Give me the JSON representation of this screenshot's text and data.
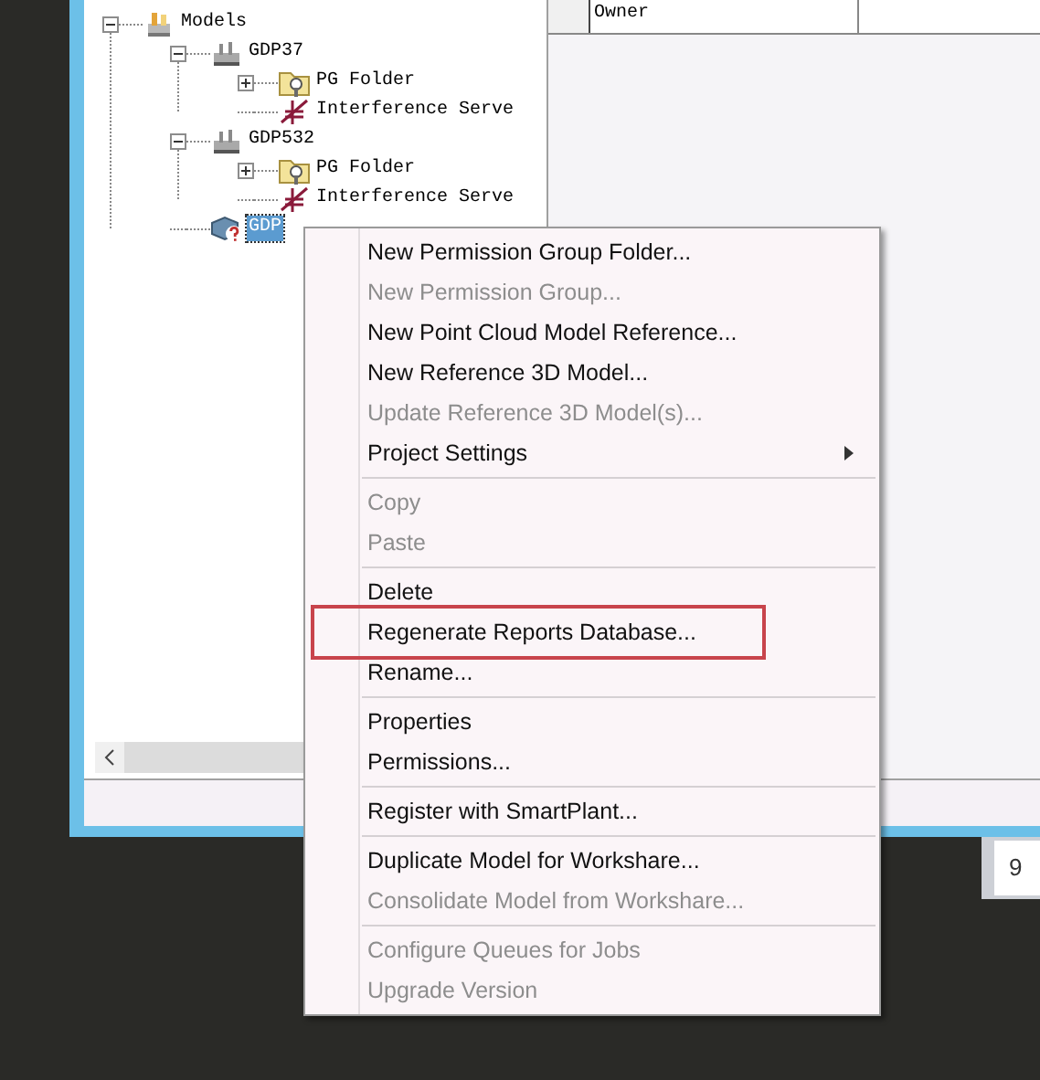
{
  "tree": [
    {
      "label": "Models",
      "kind": "models",
      "selected": false,
      "expanded": true,
      "children": [
        {
          "label": "GDP37",
          "kind": "model",
          "selected": false,
          "expanded": true,
          "children": [
            {
              "label": "PG Folder",
              "kind": "folder",
              "selected": false,
              "expanded": false
            },
            {
              "label": "Interference Serve",
              "kind": "interference",
              "selected": false
            }
          ]
        },
        {
          "label": "GDP532",
          "kind": "model",
          "selected": false,
          "expanded": true,
          "children": [
            {
              "label": "PG Folder",
              "kind": "folder",
              "selected": false,
              "expanded": false
            },
            {
              "label": "Interference Serve",
              "kind": "interference",
              "selected": false
            }
          ]
        },
        {
          "label": "GDP",
          "kind": "unknown-model",
          "selected": true
        }
      ]
    }
  ],
  "property_grid": {
    "rows": [
      {
        "label": "Owner"
      }
    ]
  },
  "other_window": {
    "text": "9"
  },
  "context_menu": [
    {
      "kind": "item",
      "label": "New Permission Group Folder...",
      "disabled": false
    },
    {
      "kind": "item",
      "label": "New Permission Group...",
      "disabled": true
    },
    {
      "kind": "item",
      "label": "New Point Cloud Model Reference...",
      "disabled": false
    },
    {
      "kind": "item",
      "label": "New Reference 3D Model...",
      "disabled": false
    },
    {
      "kind": "item",
      "label": "Update Reference 3D Model(s)...",
      "disabled": true
    },
    {
      "kind": "item",
      "label": "Project Settings",
      "disabled": false,
      "submenu": true
    },
    {
      "kind": "separator"
    },
    {
      "kind": "item",
      "label": "Copy",
      "disabled": true
    },
    {
      "kind": "item",
      "label": "Paste",
      "disabled": true
    },
    {
      "kind": "separator"
    },
    {
      "kind": "item",
      "label": "Delete",
      "disabled": false
    },
    {
      "kind": "item",
      "label": "Regenerate Reports Database...",
      "disabled": false,
      "highlighted": true
    },
    {
      "kind": "item",
      "label": "Rename...",
      "disabled": false
    },
    {
      "kind": "separator"
    },
    {
      "kind": "item",
      "label": "Properties",
      "disabled": false
    },
    {
      "kind": "item",
      "label": "Permissions...",
      "disabled": false
    },
    {
      "kind": "separator"
    },
    {
      "kind": "item",
      "label": "Register with SmartPlant...",
      "disabled": false
    },
    {
      "kind": "separator"
    },
    {
      "kind": "item",
      "label": "Duplicate Model for Workshare...",
      "disabled": false
    },
    {
      "kind": "item",
      "label": "Consolidate Model from Workshare...",
      "disabled": true
    },
    {
      "kind": "separator"
    },
    {
      "kind": "item",
      "label": "Configure Queues for Jobs",
      "disabled": true
    },
    {
      "kind": "item",
      "label": "Upgrade Version",
      "disabled": true
    }
  ]
}
